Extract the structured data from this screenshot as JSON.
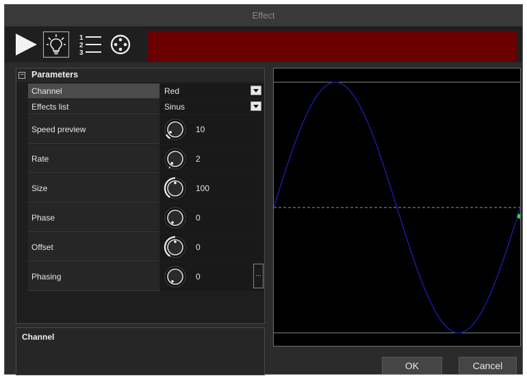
{
  "window": {
    "title": "Effect"
  },
  "toolbar": {
    "tools": [
      {
        "icon": "play-icon"
      },
      {
        "icon": "lightbulb-icon",
        "active": true
      },
      {
        "icon": "numbered-list-icon"
      },
      {
        "icon": "crosshair-icon"
      }
    ],
    "color_swatch": "#6a0000"
  },
  "parameters": {
    "header": "Parameters",
    "rows": {
      "channel": {
        "label": "Channel",
        "value": "Red"
      },
      "effects_list": {
        "label": "Effects list",
        "value": "Sinus"
      },
      "speed_preview": {
        "label": "Speed preview",
        "value": "10",
        "knob_level": 0.1
      },
      "rate": {
        "label": "Rate",
        "value": "2",
        "knob_level": 0.02
      },
      "size": {
        "label": "Size",
        "value": "100",
        "knob_level": 0.5
      },
      "phase": {
        "label": "Phase",
        "value": "0",
        "knob_level": 0.0
      },
      "offset": {
        "label": "Offset",
        "value": "0",
        "knob_level": 0.5
      },
      "phasing": {
        "label": "Phasing",
        "value": "0",
        "knob_level": 0.0,
        "button": "..."
      }
    }
  },
  "description": {
    "title": "Channel"
  },
  "graph": {
    "waveform": "sine",
    "line_color": "#1a1aa0",
    "cursor_color": "#22dd22"
  },
  "buttons": {
    "ok": "OK",
    "cancel": "Cancel"
  }
}
